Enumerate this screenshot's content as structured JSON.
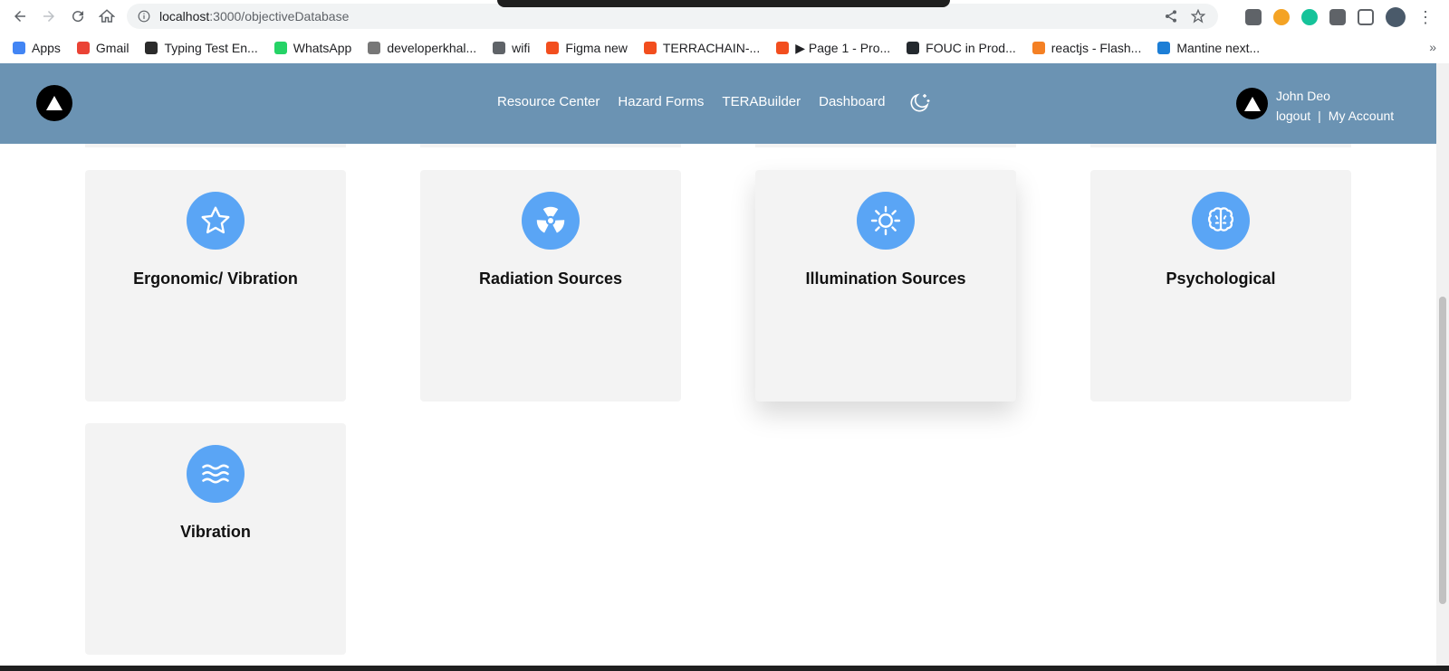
{
  "browser": {
    "url_host": "localhost",
    "url_path": ":3000/objectiveDatabase",
    "bookmarks": [
      {
        "label": "Apps",
        "color": "#4285f4"
      },
      {
        "label": "Gmail",
        "color": "#ea4335"
      },
      {
        "label": "Typing Test En...",
        "color": "#2b2b2b"
      },
      {
        "label": "WhatsApp",
        "color": "#25d366"
      },
      {
        "label": "developerkhal...",
        "color": "#777777"
      },
      {
        "label": "wifi",
        "color": "#5f6368"
      },
      {
        "label": "Figma new",
        "color": "#f24e1e"
      },
      {
        "label": "TERRACHAIN-...",
        "color": "#f24e1e"
      },
      {
        "label": "▶ Page 1 - Pro...",
        "color": "#f24e1e"
      },
      {
        "label": "FOUC in Prod...",
        "color": "#24292e"
      },
      {
        "label": "reactjs - Flash...",
        "color": "#f48024"
      },
      {
        "label": "Mantine next...",
        "color": "#1c7ed6"
      }
    ],
    "more": "»"
  },
  "header": {
    "nav": [
      "Resource Center",
      "Hazard Forms",
      "TERABuilder",
      "Dashboard"
    ],
    "user_name": "John Deo",
    "logout": "logout",
    "separator": "|",
    "account": "My Account"
  },
  "cards": [
    {
      "title": "Ergonomic/ Vibration",
      "icon": "star-icon"
    },
    {
      "title": "Radiation Sources",
      "icon": "radiation-icon"
    },
    {
      "title": "Illumination Sources",
      "icon": "sun-icon"
    },
    {
      "title": "Psychological",
      "icon": "brain-icon"
    },
    {
      "title": "Vibration",
      "icon": "waves-icon"
    }
  ],
  "colors": {
    "header": "#6b93b3",
    "icon_circle": "#5aa5f5",
    "card": "#f3f3f3"
  }
}
